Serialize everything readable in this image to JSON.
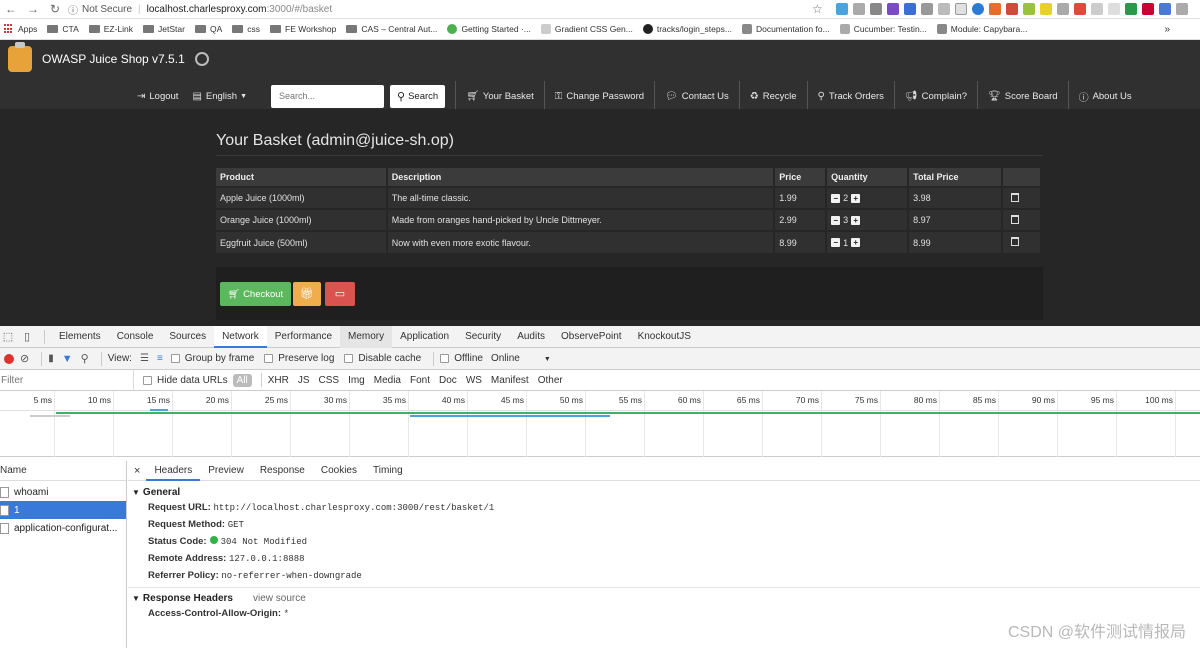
{
  "browser": {
    "not_secure": "Not Secure",
    "url_host": "localhost.charlesproxy.com",
    "url_path": ":3000/#/basket",
    "bookmarks": [
      "Apps",
      "CTA",
      "EZ-Link",
      "JetStar",
      "QA",
      "css",
      "FE Workshop",
      "CAS – Central Aut...",
      "Getting Started ·...",
      "Gradient CSS Gen...",
      "tracks/login_steps...",
      "Documentation fo...",
      "Cucumber: Testin...",
      "Module: Capybara..."
    ]
  },
  "app": {
    "brand": "OWASP Juice Shop v7.5.1",
    "logout": "Logout",
    "language": "English",
    "search_placeholder": "Search...",
    "search_btn": "Search",
    "nav": [
      "Your Basket",
      "Change Password",
      "Contact Us",
      "Recycle",
      "Track Orders",
      "Complain?",
      "Score Board",
      "About Us"
    ]
  },
  "basket": {
    "title": "Your Basket  (admin@juice-sh.op)",
    "headers": [
      "Product",
      "Description",
      "Price",
      "Quantity",
      "Total Price",
      ""
    ],
    "rows": [
      {
        "product": "Apple Juice (1000ml)",
        "desc": "The all-time classic.",
        "price": "1.99",
        "qty": "2",
        "total": "3.98"
      },
      {
        "product": "Orange Juice (1000ml)",
        "desc": "Made from oranges hand-picked by Uncle Dittmeyer.",
        "price": "2.99",
        "qty": "3",
        "total": "8.97"
      },
      {
        "product": "Eggfruit Juice (500ml)",
        "desc": "Now with even more exotic flavour.",
        "price": "8.99",
        "qty": "1",
        "total": "8.99"
      }
    ],
    "checkout": "Checkout"
  },
  "devtools": {
    "tabs": [
      "Elements",
      "Console",
      "Sources",
      "Network",
      "Performance",
      "Memory",
      "Application",
      "Security",
      "Audits",
      "ObservePoint",
      "KnockoutJS"
    ],
    "view": "View:",
    "group_by_frame": "Group by frame",
    "preserve_log": "Preserve log",
    "disable_cache": "Disable cache",
    "offline": "Offline",
    "online": "Online",
    "filter_placeholder": "Filter",
    "hide_data_urls": "Hide data URLs",
    "types": [
      "All",
      "XHR",
      "JS",
      "CSS",
      "Img",
      "Media",
      "Font",
      "Doc",
      "WS",
      "Manifest",
      "Other"
    ],
    "ticks": [
      "5 ms",
      "10 ms",
      "15 ms",
      "20 ms",
      "25 ms",
      "30 ms",
      "35 ms",
      "40 ms",
      "45 ms",
      "50 ms",
      "55 ms",
      "60 ms",
      "65 ms",
      "70 ms",
      "75 ms",
      "80 ms",
      "85 ms",
      "90 ms",
      "95 ms",
      "100 ms"
    ],
    "name_header": "Name",
    "requests": [
      "whoami",
      "1",
      "application-configurat..."
    ],
    "detail_tabs": [
      "Headers",
      "Preview",
      "Response",
      "Cookies",
      "Timing"
    ],
    "general": "General",
    "request_url_k": "Request URL:",
    "request_url_v": "http://localhost.charlesproxy.com:3000/rest/basket/1",
    "request_method_k": "Request Method:",
    "request_method_v": "GET",
    "status_code_k": "Status Code:",
    "status_code_v": "304 Not Modified",
    "remote_address_k": "Remote Address:",
    "remote_address_v": "127.0.0.1:8888",
    "referrer_policy_k": "Referrer Policy:",
    "referrer_policy_v": "no-referrer-when-downgrade",
    "response_headers": "Response Headers",
    "view_source": "view source",
    "acao_k": "Access-Control-Allow-Origin:",
    "acao_v": "*"
  },
  "watermark": "CSDN @软件测试情报局"
}
